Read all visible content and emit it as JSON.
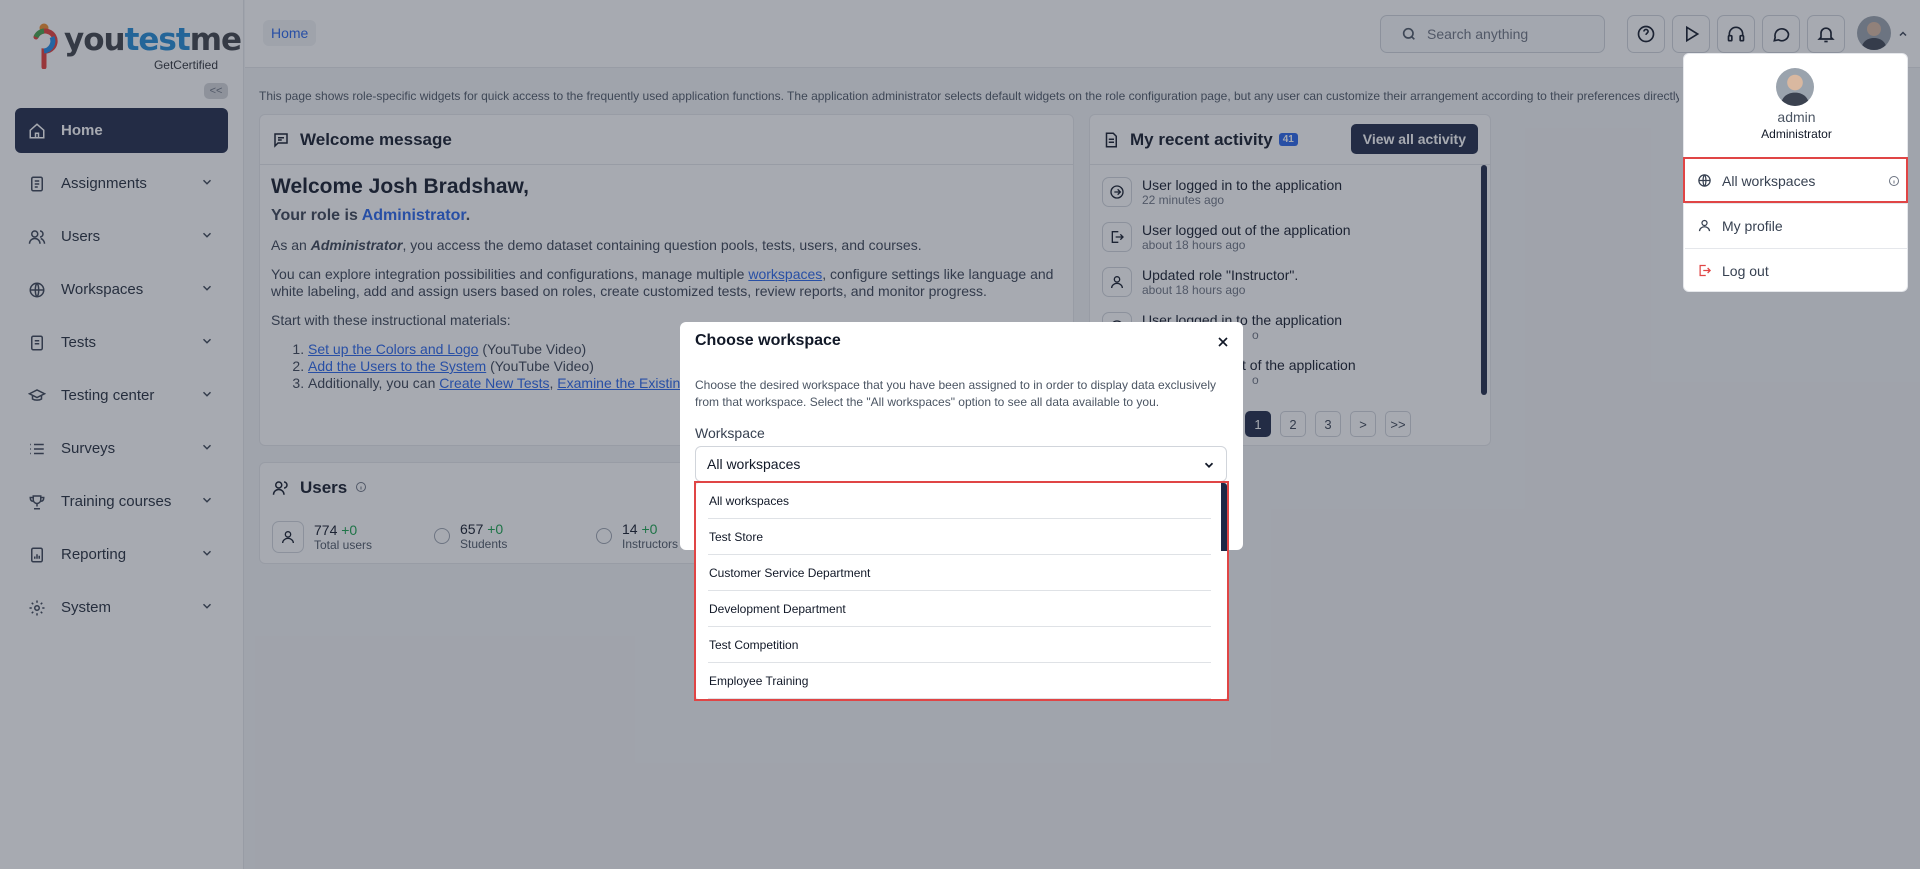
{
  "app": {
    "logo_text_a": "you",
    "logo_text_b": "test",
    "logo_text_c": "me",
    "logo_sub": "GetCertified",
    "collapse": "<<"
  },
  "sidebar": {
    "items": [
      {
        "label": "Home",
        "icon": "home-icon"
      },
      {
        "label": "Assignments",
        "icon": "assignments-icon"
      },
      {
        "label": "Users",
        "icon": "users-icon"
      },
      {
        "label": "Workspaces",
        "icon": "globe-icon"
      },
      {
        "label": "Tests",
        "icon": "tests-icon"
      },
      {
        "label": "Testing center",
        "icon": "testing-center-icon"
      },
      {
        "label": "Surveys",
        "icon": "list-icon"
      },
      {
        "label": "Training courses",
        "icon": "trophy-icon"
      },
      {
        "label": "Reporting",
        "icon": "report-icon"
      },
      {
        "label": "System",
        "icon": "gear-icon"
      }
    ]
  },
  "header": {
    "breadcrumb": "Home",
    "search_placeholder": "Search anything"
  },
  "info_text": "This page shows role-specific widgets for quick access to the frequently used application functions. The application administrator selects default widgets on the role configuration page, but any user can customize their arrangement according to their preferences directly",
  "welcome": {
    "title": "Welcome message",
    "heading": "Welcome Josh Bradshaw,",
    "role_prefix": "Your role is ",
    "role": "Administrator",
    "role_suffix": ".",
    "p1_a": "As an ",
    "p1_b": "Administrator",
    "p1_c": ", you access the demo dataset containing question pools, tests, users, and courses.",
    "p2_a": "You can explore integration possibilities and configurations, manage multiple ",
    "p2_link": "workspaces",
    "p2_b": ", configure settings like language and white labeling, add and assign users based on roles, create customized tests, review reports, and monitor progress.",
    "p3": "Start with these instructional materials:",
    "l1_link": "Set up the Colors and Logo",
    "l1_rest": " (YouTube Video)",
    "l2_link": "Add the Users to the System",
    "l2_rest": " (YouTube Video)",
    "l3_a": "Additionally, you can ",
    "l3_link1": "Create New Tests",
    "l3_sep": ", ",
    "l3_link2": "Examine the Existin"
  },
  "users_widget": {
    "title": "Users",
    "stats": [
      {
        "value": "774",
        "delta": "+0",
        "label": "Total users"
      },
      {
        "value": "657",
        "delta": "+0",
        "label": "Students"
      },
      {
        "value": "14",
        "delta": "+0",
        "label": "Instructors"
      }
    ]
  },
  "activity": {
    "title": "My recent activity",
    "badge": "41",
    "view_all": "View all activity",
    "items": [
      {
        "title": "User logged in to the application",
        "time": "22 minutes ago"
      },
      {
        "title": "User logged out of the application",
        "time": "about 18 hours ago"
      },
      {
        "title": "Updated role \"Instructor\".",
        "time": "about 18 hours ago"
      },
      {
        "title": "User logged in to the application",
        "time": "o"
      },
      {
        "title": "t of the application",
        "time": "o"
      }
    ],
    "pages": [
      "1",
      "2",
      "3",
      ">",
      ">>"
    ]
  },
  "modal": {
    "title": "Choose workspace",
    "description": "Choose the desired workspace that you have been assigned to in order to display data exclusively from that workspace. Select the \"All workspaces\" option to see all data available to you.",
    "label": "Workspace",
    "selected": "All workspaces",
    "options": [
      "All workspaces",
      "Test Store",
      "Customer Service Department",
      "Development Department",
      "Test Competition",
      "Employee Training"
    ]
  },
  "user_menu": {
    "name": "admin",
    "role": "Administrator",
    "items": [
      {
        "label": "All workspaces",
        "icon": "globe-icon"
      },
      {
        "label": "My profile",
        "icon": "user-icon"
      },
      {
        "label": "Log out",
        "icon": "logout-icon"
      }
    ]
  },
  "colors": {
    "accent": "#1c2745",
    "link": "#2563eb",
    "highlight": "#e04545"
  }
}
